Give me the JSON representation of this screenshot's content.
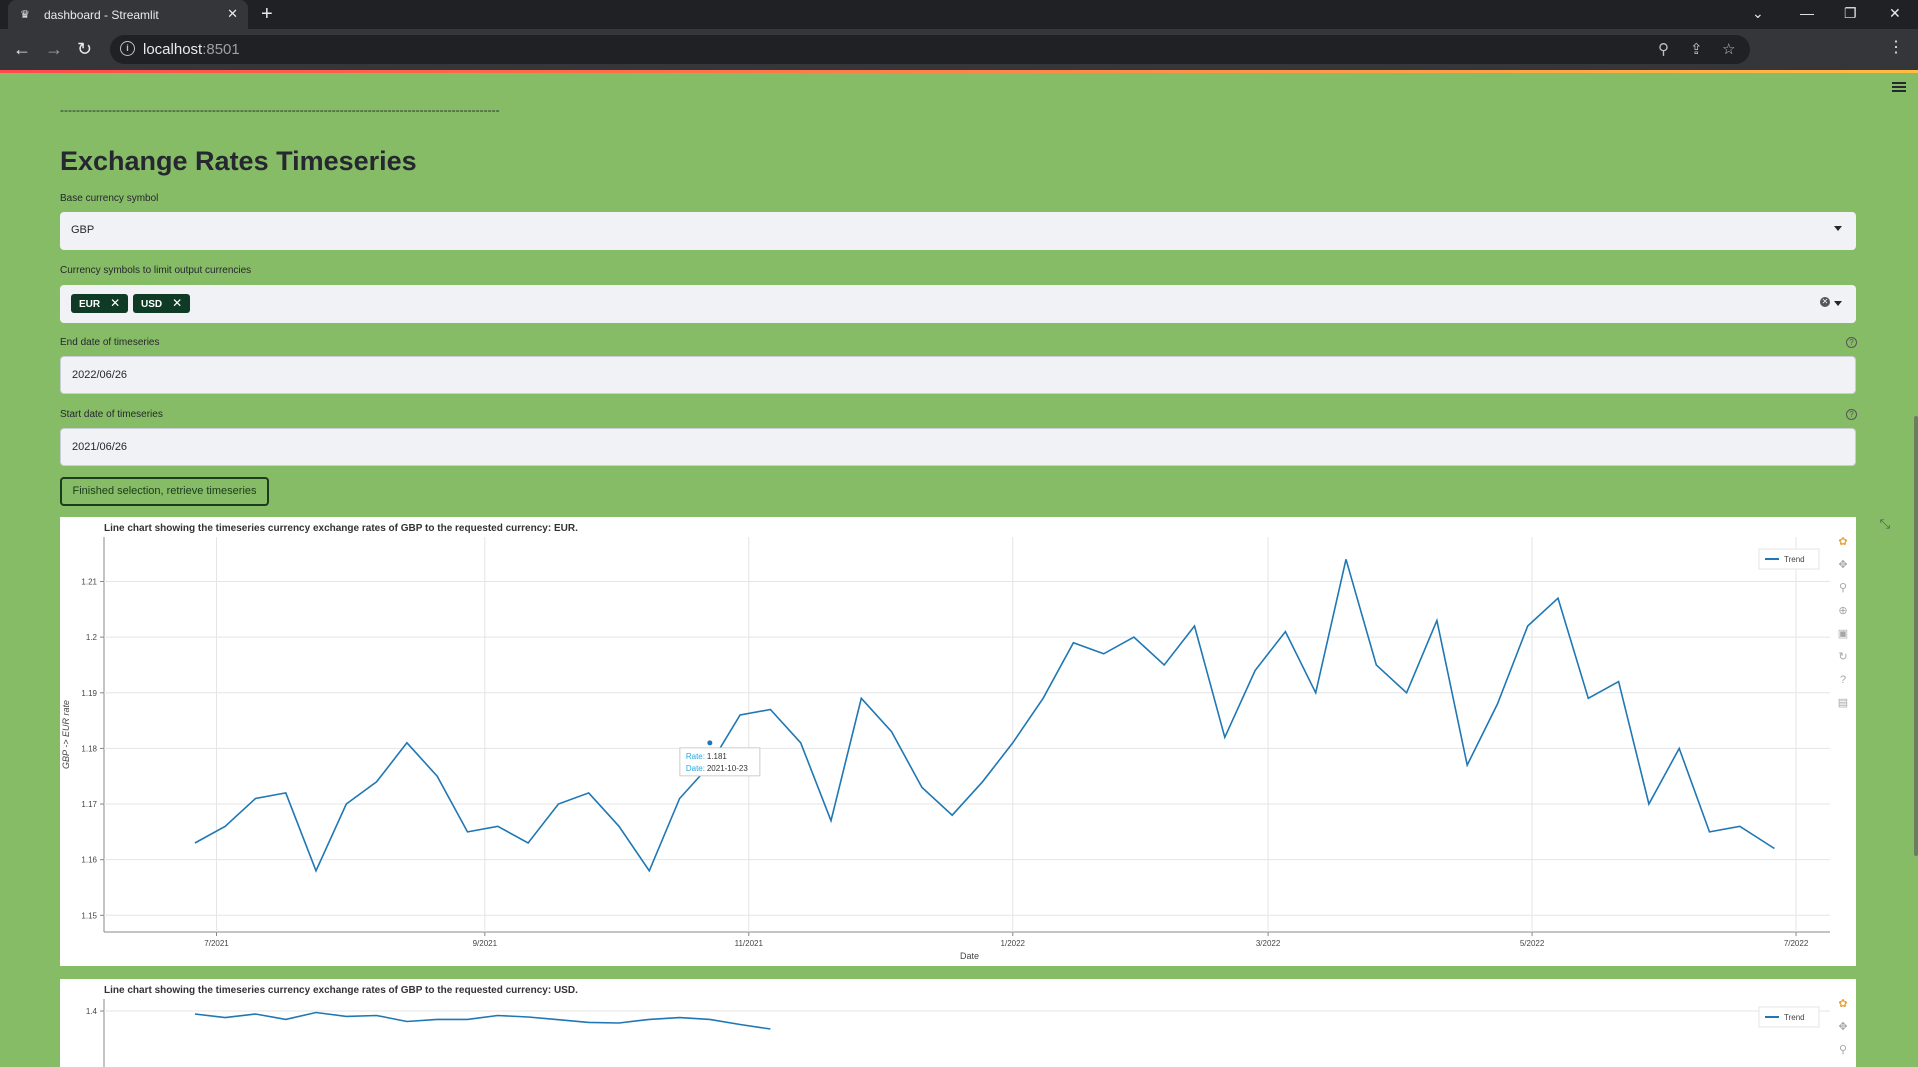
{
  "browser": {
    "tab_title": "dashboard - Streamlit",
    "url_host": "localhost",
    "url_port": ":8501"
  },
  "app": {
    "divider_text": "--------------------------------------------------------------------------------------------------------------",
    "title": "Exchange Rates Timeseries",
    "base_label": "Base currency symbol",
    "base_value": "GBP",
    "symbols_label": "Currency symbols to limit output currencies",
    "symbols": [
      "EUR",
      "USD"
    ],
    "end_label": "End date of timeseries",
    "end_value": "2022/06/26",
    "start_label": "Start date of timeseries",
    "start_value": "2021/06/26",
    "button_label": "Finished selection, retrieve timeseries"
  },
  "chart_data": [
    {
      "type": "line",
      "title": "Line chart showing the timeseries currency exchange rates of GBP to the requested currency: EUR.",
      "xlabel": "Date",
      "ylabel": "GBP -> EUR rate",
      "legend": "Trend",
      "legend_position": "top-right",
      "grid": true,
      "ylim": [
        1.147,
        1.218
      ],
      "xlim": [
        "2021-06-05",
        "2022-07-10"
      ],
      "x_ticks": [
        "7/2021",
        "9/2021",
        "11/2021",
        "1/2022",
        "3/2022",
        "5/2022",
        "7/2022"
      ],
      "y_ticks": [
        1.15,
        1.16,
        1.17,
        1.18,
        1.19,
        1.2,
        1.21
      ],
      "tooltip": {
        "rate_label": "Rate:",
        "rate": "1.181",
        "date_label": "Date:",
        "date": "2021-10-23"
      },
      "x": [
        "2021-06-26",
        "2021-07-03",
        "2021-07-10",
        "2021-07-17",
        "2021-07-24",
        "2021-07-31",
        "2021-08-07",
        "2021-08-14",
        "2021-08-21",
        "2021-08-28",
        "2021-09-04",
        "2021-09-11",
        "2021-09-18",
        "2021-09-25",
        "2021-10-02",
        "2021-10-09",
        "2021-10-16",
        "2021-10-23",
        "2021-10-30",
        "2021-11-06",
        "2021-11-13",
        "2021-11-20",
        "2021-11-27",
        "2021-12-04",
        "2021-12-11",
        "2021-12-18",
        "2021-12-25",
        "2022-01-01",
        "2022-01-08",
        "2022-01-15",
        "2022-01-22",
        "2022-01-29",
        "2022-02-05",
        "2022-02-12",
        "2022-02-19",
        "2022-02-26",
        "2022-03-05",
        "2022-03-12",
        "2022-03-19",
        "2022-03-26",
        "2022-04-02",
        "2022-04-09",
        "2022-04-16",
        "2022-04-23",
        "2022-04-30",
        "2022-05-07",
        "2022-05-14",
        "2022-05-21",
        "2022-05-28",
        "2022-06-04",
        "2022-06-11",
        "2022-06-18",
        "2022-06-26"
      ],
      "values": [
        1.163,
        1.166,
        1.171,
        1.172,
        1.158,
        1.17,
        1.174,
        1.181,
        1.175,
        1.165,
        1.166,
        1.163,
        1.17,
        1.172,
        1.166,
        1.158,
        1.171,
        1.177,
        1.186,
        1.187,
        1.181,
        1.167,
        1.189,
        1.183,
        1.173,
        1.168,
        1.174,
        1.181,
        1.189,
        1.199,
        1.197,
        1.2,
        1.195,
        1.202,
        1.182,
        1.194,
        1.201,
        1.19,
        1.214,
        1.195,
        1.19,
        1.203,
        1.177,
        1.188,
        1.202,
        1.207,
        1.189,
        1.192,
        1.17,
        1.18,
        1.165,
        1.166,
        1.162
      ]
    },
    {
      "type": "line",
      "title": "Line chart showing the timeseries currency exchange rates of GBP to the requested currency: USD.",
      "legend": "Trend",
      "legend_position": "top-right",
      "grid": true,
      "y_ticks": [
        1.4
      ],
      "x": [
        "2021-06-26",
        "2021-07-03",
        "2021-07-10",
        "2021-07-17",
        "2021-07-24",
        "2021-07-31",
        "2021-08-07",
        "2021-08-14",
        "2021-08-21",
        "2021-08-28",
        "2021-09-04",
        "2021-09-11",
        "2021-09-18",
        "2021-09-25",
        "2021-10-02",
        "2021-10-09",
        "2021-10-16",
        "2021-10-23",
        "2021-10-30",
        "2021-11-06"
      ],
      "values": [
        1.39,
        1.378,
        1.39,
        1.372,
        1.395,
        1.382,
        1.385,
        1.365,
        1.372,
        1.372,
        1.385,
        1.38,
        1.371,
        1.362,
        1.36,
        1.372,
        1.378,
        1.372,
        1.355,
        1.34
      ]
    }
  ]
}
